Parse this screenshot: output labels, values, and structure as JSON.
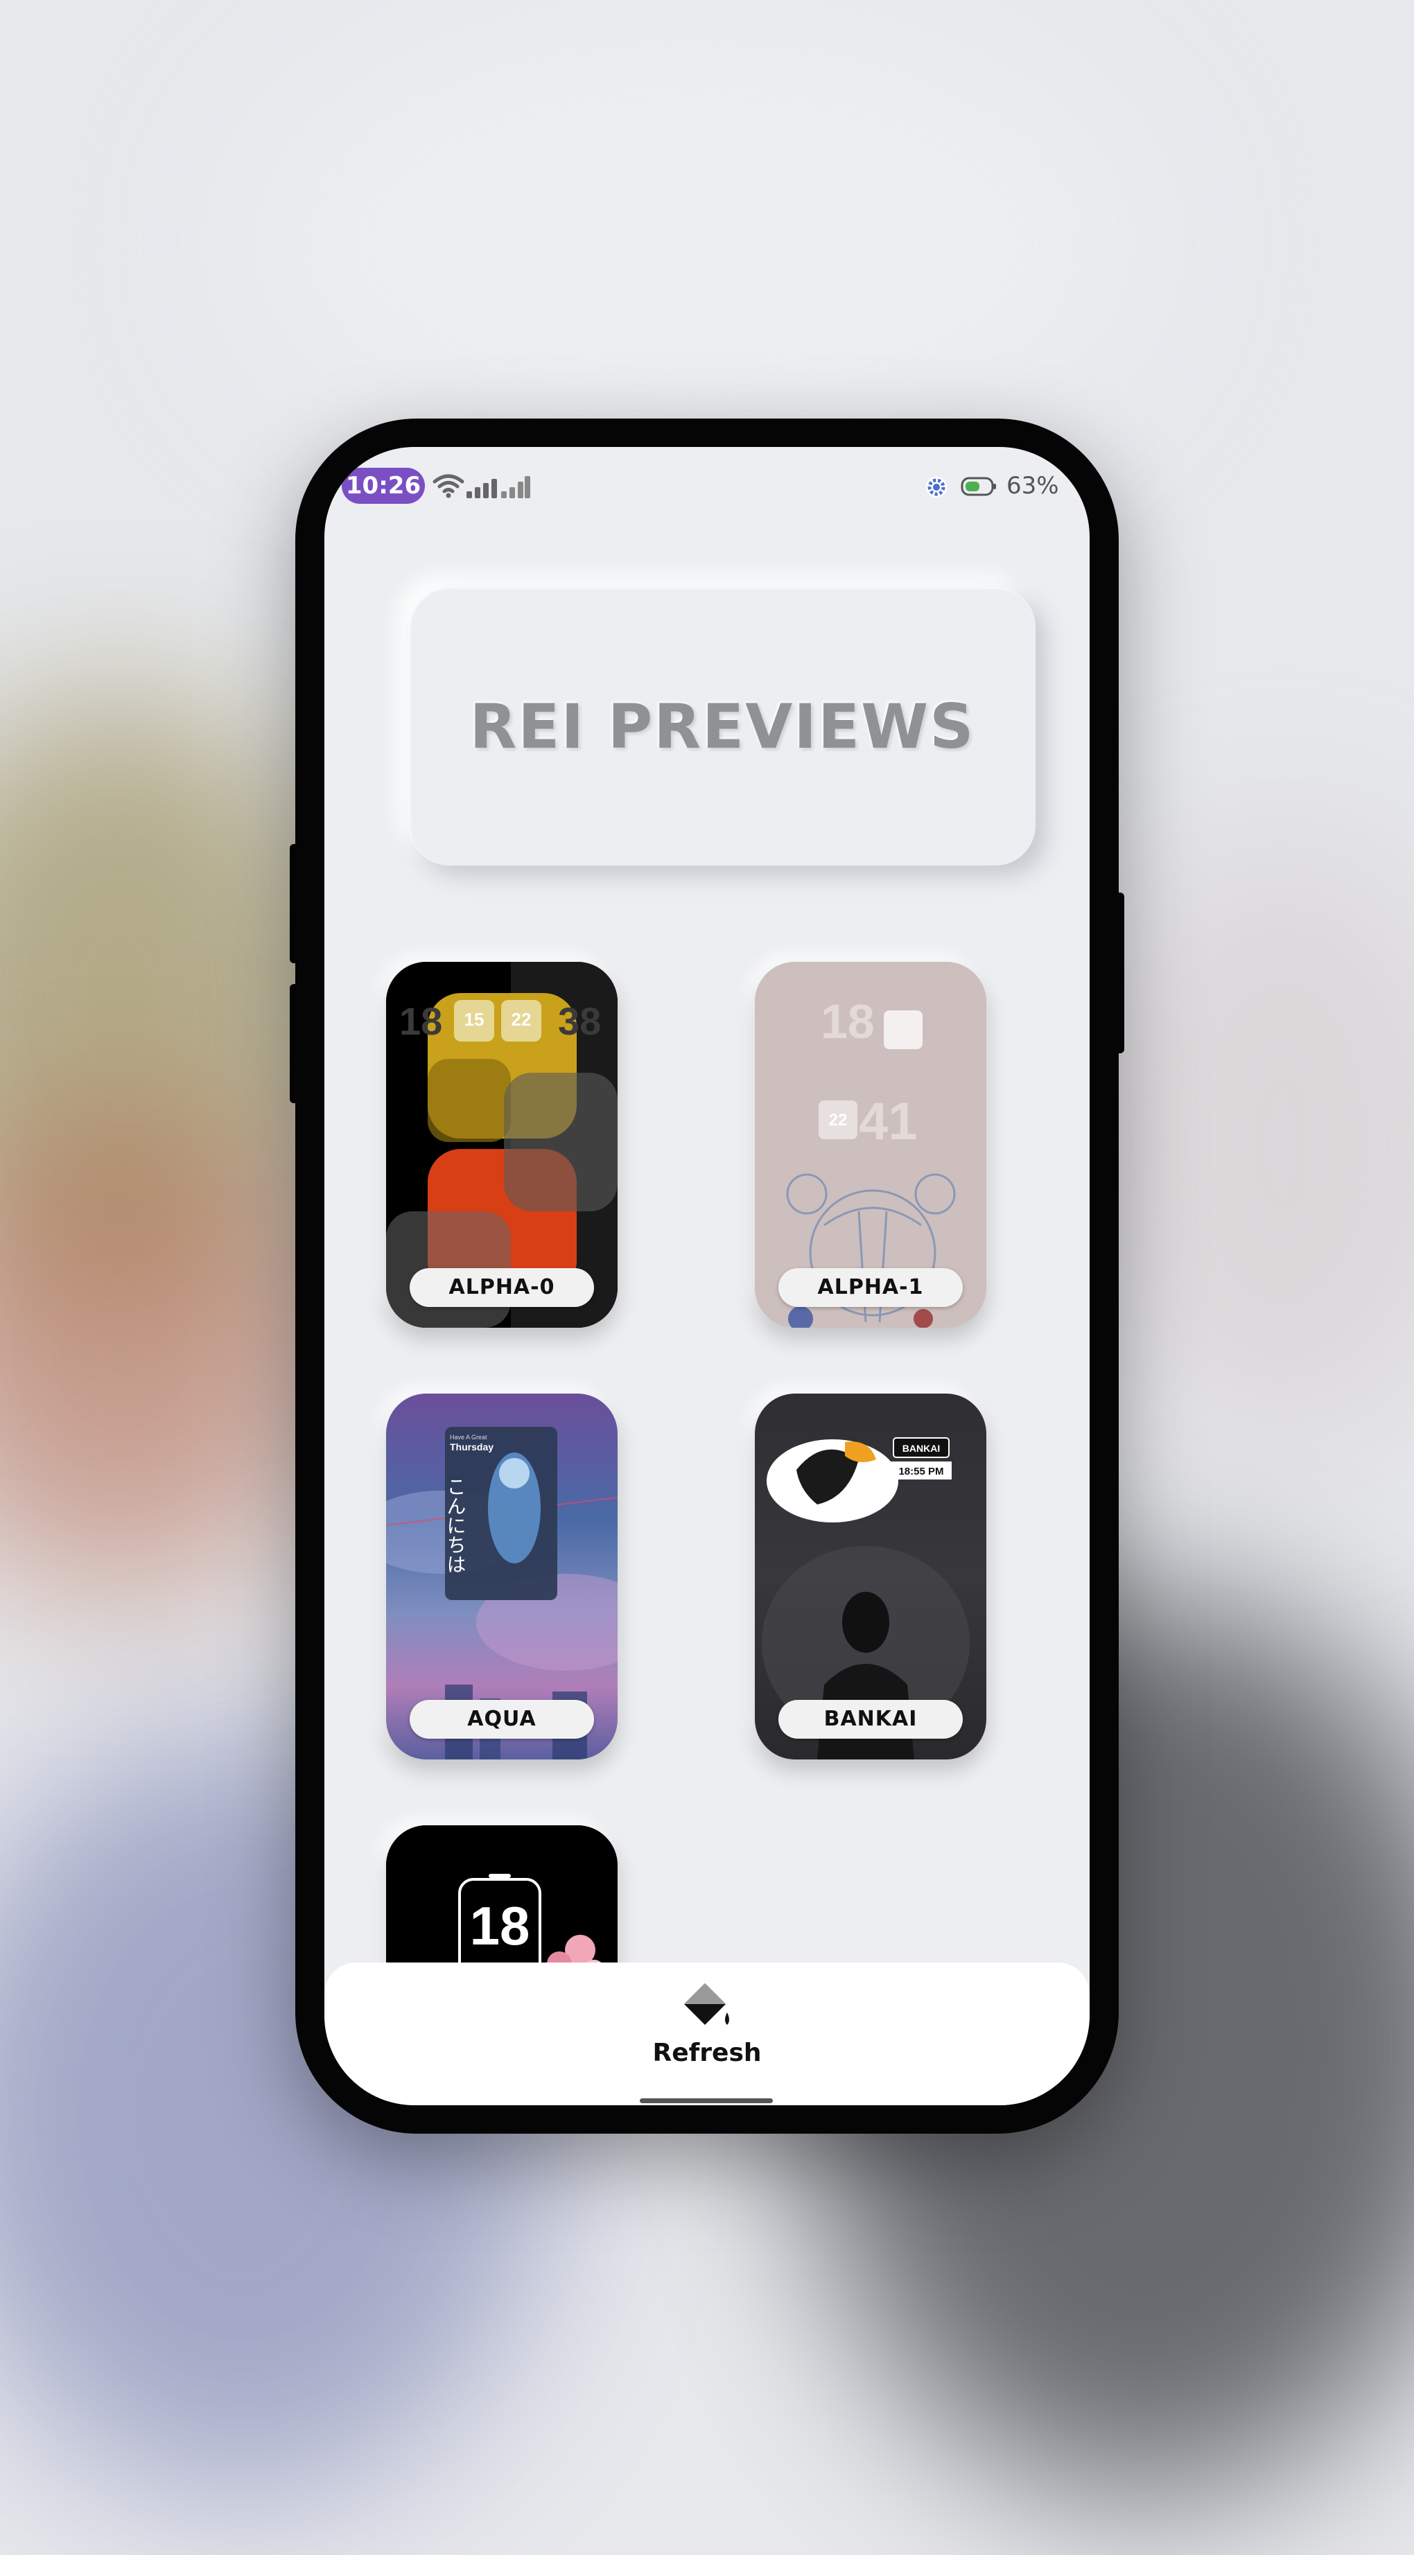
{
  "status_bar": {
    "time": "10:26",
    "battery": "63%",
    "icons": [
      "wifi-icon",
      "signal-icon",
      "settings-icon",
      "battery-icon"
    ]
  },
  "header": {
    "title": "REI PREVIEWS"
  },
  "previews": [
    {
      "label": "ALPHA-0",
      "hour": "18",
      "minute": "38",
      "date_day": "15",
      "date_day2": "22"
    },
    {
      "label": "ALPHA-1",
      "hour": "18",
      "minute": "41",
      "date_day": "22"
    },
    {
      "label": "AQUA",
      "day_name": "Thursday",
      "japanese": "こんにちは"
    },
    {
      "label": "BANKAI",
      "badge": "BANKAI",
      "time": "18:55 PM"
    },
    {
      "label": "",
      "hour": "18"
    }
  ],
  "bottom_bar": {
    "refresh_label": "Refresh",
    "icon": "paint-bucket-icon"
  },
  "colors": {
    "accent": "#7a4fc4",
    "background": "#eceef1",
    "title_text": "#8f9193"
  }
}
